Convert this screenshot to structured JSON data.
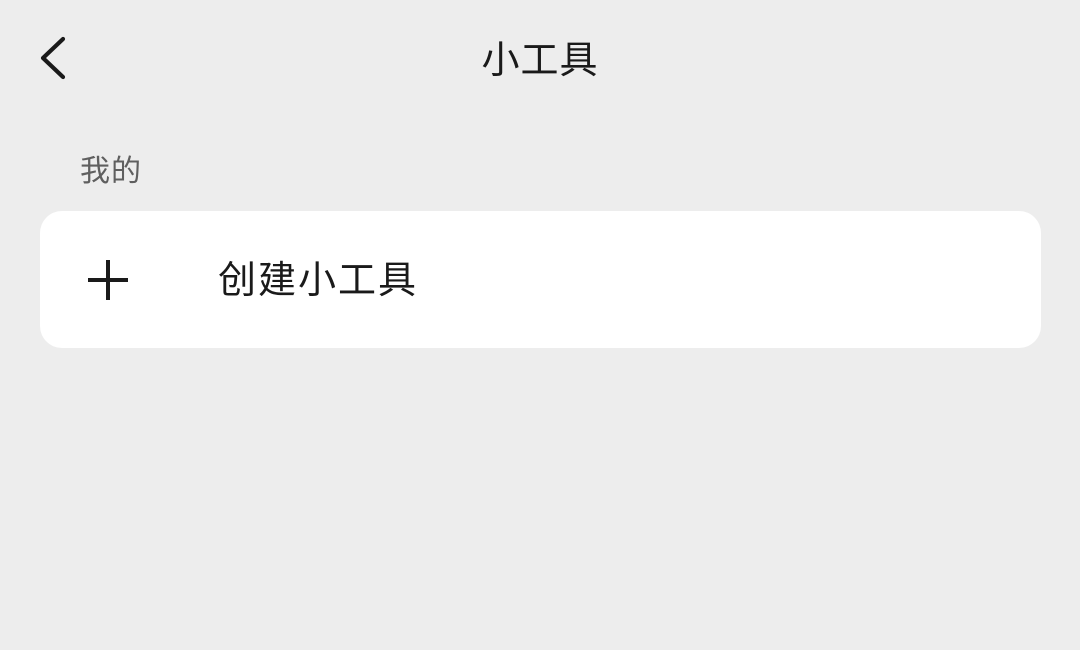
{
  "header": {
    "title": "小工具",
    "back_icon": "chevron-left-icon"
  },
  "sections": {
    "mine": {
      "label": "我的",
      "create_tool": {
        "icon": "plus-icon",
        "label": "创建小工具"
      }
    }
  },
  "colors": {
    "background": "#ededed",
    "card": "#ffffff",
    "text": "#1a1a1a",
    "secondary_text": "#5f5f5f"
  }
}
